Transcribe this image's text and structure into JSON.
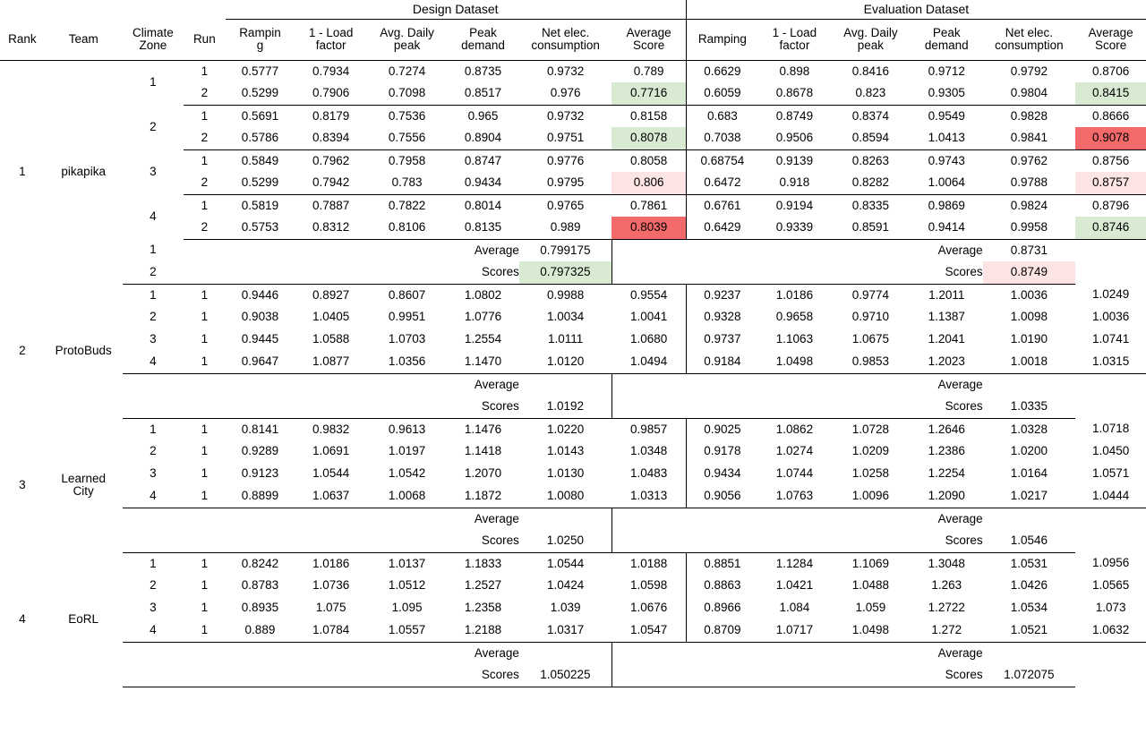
{
  "table": {
    "bands": {
      "left_spacer": "",
      "design": "Design Dataset",
      "evaluation": "Evaluation Dataset"
    },
    "headers": {
      "rank": "Rank",
      "team": "Team",
      "climate_zone_l1": "Climate",
      "climate_zone_l2": "Zone",
      "run": "Run",
      "design": [
        {
          "l1": "Rampin",
          "l2": "g"
        },
        {
          "l1": "1 - Load",
          "l2": "factor"
        },
        {
          "l1": "Avg. Daily",
          "l2": "peak"
        },
        {
          "l1": "Peak",
          "l2": "demand"
        },
        {
          "l1": "Net elec.",
          "l2": "consumption"
        },
        {
          "l1": "Average",
          "l2": "Score"
        }
      ],
      "evaluation": [
        {
          "l1": "",
          "l2": "Ramping"
        },
        {
          "l1": "1 - Load",
          "l2": "factor"
        },
        {
          "l1": "Avg. Daily",
          "l2": "peak"
        },
        {
          "l1": "Peak",
          "l2": "demand"
        },
        {
          "l1": "Net elec.",
          "l2": "consumption"
        },
        {
          "l1": "Average",
          "l2": "Score"
        }
      ]
    },
    "avg_label_l1": "Average",
    "avg_label_l2": "Scores",
    "colors": {
      "highlight_green": "#d9ead3",
      "highlight_pink": "#fce4e4",
      "highlight_red": "#f4696a"
    },
    "teams": [
      {
        "rank": "1",
        "name": "pikapika",
        "name_l1": "pikapika",
        "name_l2": "",
        "rows": [
          {
            "zone": "1",
            "run": "1",
            "design": [
              "0.5777",
              "0.7934",
              "0.7274",
              "0.8735",
              "0.9732",
              "0.789"
            ],
            "design_avg_hl": "none",
            "eval": [
              "0.6629",
              "0.898",
              "0.8416",
              "0.9712",
              "0.9792",
              "0.8706"
            ],
            "eval_avg_hl": "none"
          },
          {
            "zone": "",
            "run": "2",
            "design": [
              "0.5299",
              "0.7906",
              "0.7098",
              "0.8517",
              "0.976",
              "0.7716"
            ],
            "design_avg_hl": "green",
            "eval": [
              "0.6059",
              "0.8678",
              "0.823",
              "0.9305",
              "0.9804",
              "0.8415"
            ],
            "eval_avg_hl": "green",
            "group_end": true
          },
          {
            "zone": "2",
            "run": "1",
            "design": [
              "0.5691",
              "0.8179",
              "0.7536",
              "0.965",
              "0.9732",
              "0.8158"
            ],
            "design_avg_hl": "none",
            "eval": [
              "0.683",
              "0.8749",
              "0.8374",
              "0.9549",
              "0.9828",
              "0.8666"
            ],
            "eval_avg_hl": "none"
          },
          {
            "zone": "",
            "run": "2",
            "design": [
              "0.5786",
              "0.8394",
              "0.7556",
              "0.8904",
              "0.9751",
              "0.8078"
            ],
            "design_avg_hl": "green",
            "eval": [
              "0.7038",
              "0.9506",
              "0.8594",
              "1.0413",
              "0.9841",
              "0.9078"
            ],
            "eval_avg_hl": "red",
            "group_end": true
          },
          {
            "zone": "3",
            "run": "1",
            "design": [
              "0.5849",
              "0.7962",
              "0.7958",
              "0.8747",
              "0.9776",
              "0.8058"
            ],
            "design_avg_hl": "none",
            "eval": [
              "0.68754",
              "0.9139",
              "0.8263",
              "0.9743",
              "0.9762",
              "0.8756"
            ],
            "eval_avg_hl": "none"
          },
          {
            "zone": "",
            "run": "2",
            "design": [
              "0.5299",
              "0.7942",
              "0.783",
              "0.9434",
              "0.9795",
              "0.806"
            ],
            "design_avg_hl": "pink",
            "eval": [
              "0.6472",
              "0.918",
              "0.8282",
              "1.0064",
              "0.9788",
              "0.8757"
            ],
            "eval_avg_hl": "pink",
            "group_end": true
          },
          {
            "zone": "4",
            "run": "1",
            "design": [
              "0.5819",
              "0.7887",
              "0.7822",
              "0.8014",
              "0.9765",
              "0.7861"
            ],
            "design_avg_hl": "none",
            "eval": [
              "0.6761",
              "0.9194",
              "0.8335",
              "0.9869",
              "0.9824",
              "0.8796"
            ],
            "eval_avg_hl": "none"
          },
          {
            "zone": "",
            "run": "2",
            "design": [
              "0.5753",
              "0.8312",
              "0.8106",
              "0.8135",
              "0.989",
              "0.8039"
            ],
            "design_avg_hl": "red",
            "eval": [
              "0.6429",
              "0.9339",
              "0.8591",
              "0.9414",
              "0.9958",
              "0.8746"
            ],
            "eval_avg_hl": "green",
            "group_end": true
          }
        ],
        "summary_rows": [
          {
            "run": "1",
            "design_avg": "0.799175",
            "design_hl": "none",
            "design_bold": false,
            "eval_avg": "0.8731",
            "eval_hl": "none",
            "eval_bold": true
          },
          {
            "run": "2",
            "design_avg": "0.797325",
            "design_hl": "green",
            "design_bold": true,
            "eval_avg": "0.8749",
            "eval_hl": "pink",
            "eval_bold": false
          }
        ]
      },
      {
        "rank": "2",
        "name": "ProtoBuds",
        "name_l1": "ProtoBuds",
        "name_l2": "",
        "rows": [
          {
            "zone": "1",
            "run": "1",
            "design": [
              "0.9446",
              "0.8927",
              "0.8607",
              "1.0802",
              "0.9988",
              "0.9554"
            ],
            "design_avg_hl": "none",
            "eval": [
              "0.9237",
              "1.0186",
              "0.9774",
              "1.2011",
              "1.0036",
              "1.0249"
            ],
            "eval_avg_hl": "none"
          },
          {
            "zone": "2",
            "run": "1",
            "design": [
              "0.9038",
              "1.0405",
              "0.9951",
              "1.0776",
              "1.0034",
              "1.0041"
            ],
            "design_avg_hl": "none",
            "eval": [
              "0.9328",
              "0.9658",
              "0.9710",
              "1.1387",
              "1.0098",
              "1.0036"
            ],
            "eval_avg_hl": "none"
          },
          {
            "zone": "3",
            "run": "1",
            "design": [
              "0.9445",
              "1.0588",
              "1.0703",
              "1.2554",
              "1.0111",
              "1.0680"
            ],
            "design_avg_hl": "none",
            "eval": [
              "0.9737",
              "1.1063",
              "1.0675",
              "1.2041",
              "1.0190",
              "1.0741"
            ],
            "eval_avg_hl": "none"
          },
          {
            "zone": "4",
            "run": "1",
            "design": [
              "0.9647",
              "1.0877",
              "1.0356",
              "1.1470",
              "1.0120",
              "1.0494"
            ],
            "design_avg_hl": "none",
            "eval": [
              "0.9184",
              "1.0498",
              "0.9853",
              "1.2023",
              "1.0018",
              "1.0315"
            ],
            "eval_avg_hl": "none",
            "group_end": true
          }
        ],
        "summary_rows": [
          {
            "run": "",
            "design_avg": "",
            "design_hl": "none",
            "design_bold": false,
            "eval_avg": "",
            "eval_hl": "none",
            "eval_bold": false
          },
          {
            "run": "",
            "design_avg": "1.0192",
            "design_hl": "none",
            "design_bold": true,
            "eval_avg": "1.0335",
            "eval_hl": "none",
            "eval_bold": true
          }
        ]
      },
      {
        "rank": "3",
        "name": "Learned City",
        "name_l1": "Learned",
        "name_l2": "City",
        "rows": [
          {
            "zone": "1",
            "run": "1",
            "design": [
              "0.8141",
              "0.9832",
              "0.9613",
              "1.1476",
              "1.0220",
              "0.9857"
            ],
            "design_avg_hl": "none",
            "eval": [
              "0.9025",
              "1.0862",
              "1.0728",
              "1.2646",
              "1.0328",
              "1.0718"
            ],
            "eval_avg_hl": "none"
          },
          {
            "zone": "2",
            "run": "1",
            "design": [
              "0.9289",
              "1.0691",
              "1.0197",
              "1.1418",
              "1.0143",
              "1.0348"
            ],
            "design_avg_hl": "none",
            "eval": [
              "0.9178",
              "1.0274",
              "1.0209",
              "1.2386",
              "1.0200",
              "1.0450"
            ],
            "eval_avg_hl": "none"
          },
          {
            "zone": "3",
            "run": "1",
            "design": [
              "0.9123",
              "1.0544",
              "1.0542",
              "1.2070",
              "1.0130",
              "1.0483"
            ],
            "design_avg_hl": "none",
            "eval": [
              "0.9434",
              "1.0744",
              "1.0258",
              "1.2254",
              "1.0164",
              "1.0571"
            ],
            "eval_avg_hl": "none"
          },
          {
            "zone": "4",
            "run": "1",
            "design": [
              "0.8899",
              "1.0637",
              "1.0068",
              "1.1872",
              "1.0080",
              "1.0313"
            ],
            "design_avg_hl": "none",
            "eval": [
              "0.9056",
              "1.0763",
              "1.0096",
              "1.2090",
              "1.0217",
              "1.0444"
            ],
            "eval_avg_hl": "none",
            "group_end": true
          }
        ],
        "summary_rows": [
          {
            "run": "",
            "design_avg": "",
            "design_hl": "none",
            "design_bold": false,
            "eval_avg": "",
            "eval_hl": "none",
            "eval_bold": false
          },
          {
            "run": "",
            "design_avg": "1.0250",
            "design_hl": "none",
            "design_bold": true,
            "eval_avg": "1.0546",
            "eval_hl": "none",
            "eval_bold": true
          }
        ]
      },
      {
        "rank": "4",
        "name": "EoRL",
        "name_l1": "EoRL",
        "name_l2": "",
        "rows": [
          {
            "zone": "1",
            "run": "1",
            "design": [
              "0.8242",
              "1.0186",
              "1.0137",
              "1.1833",
              "1.0544",
              "1.0188"
            ],
            "design_avg_hl": "none",
            "eval": [
              "0.8851",
              "1.1284",
              "1.1069",
              "1.3048",
              "1.0531",
              "1.0956"
            ],
            "eval_avg_hl": "none"
          },
          {
            "zone": "2",
            "run": "1",
            "design": [
              "0.8783",
              "1.0736",
              "1.0512",
              "1.2527",
              "1.0424",
              "1.0598"
            ],
            "design_avg_hl": "none",
            "eval": [
              "0.8863",
              "1.0421",
              "1.0488",
              "1.263",
              "1.0426",
              "1.0565"
            ],
            "eval_avg_hl": "none"
          },
          {
            "zone": "3",
            "run": "1",
            "design": [
              "0.8935",
              "1.075",
              "1.095",
              "1.2358",
              "1.039",
              "1.0676"
            ],
            "design_avg_hl": "none",
            "eval": [
              "0.8966",
              "1.084",
              "1.059",
              "1.2722",
              "1.0534",
              "1.073"
            ],
            "eval_avg_hl": "none"
          },
          {
            "zone": "4",
            "run": "1",
            "design": [
              "0.889",
              "1.0784",
              "1.0557",
              "1.2188",
              "1.0317",
              "1.0547"
            ],
            "design_avg_hl": "none",
            "eval": [
              "0.8709",
              "1.0717",
              "1.0498",
              "1.272",
              "1.0521",
              "1.0632"
            ],
            "eval_avg_hl": "none",
            "group_end": true
          }
        ],
        "summary_rows": [
          {
            "run": "",
            "design_avg": "",
            "design_hl": "none",
            "design_bold": false,
            "eval_avg": "",
            "eval_hl": "none",
            "eval_bold": false
          },
          {
            "run": "",
            "design_avg": "1.050225",
            "design_hl": "none",
            "design_bold": true,
            "eval_avg": "1.072075",
            "eval_hl": "none",
            "eval_bold": true
          }
        ]
      }
    ]
  }
}
